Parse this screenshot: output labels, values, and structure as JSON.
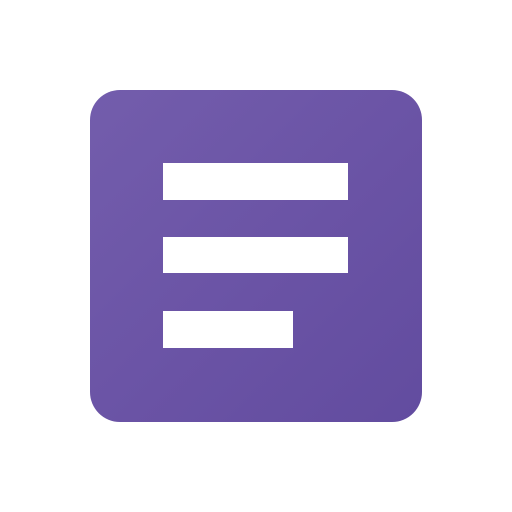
{
  "icon": {
    "name": "text-lines-icon",
    "background_color": "#6b55a6",
    "line_color": "#ffffff",
    "line_count": 3
  }
}
